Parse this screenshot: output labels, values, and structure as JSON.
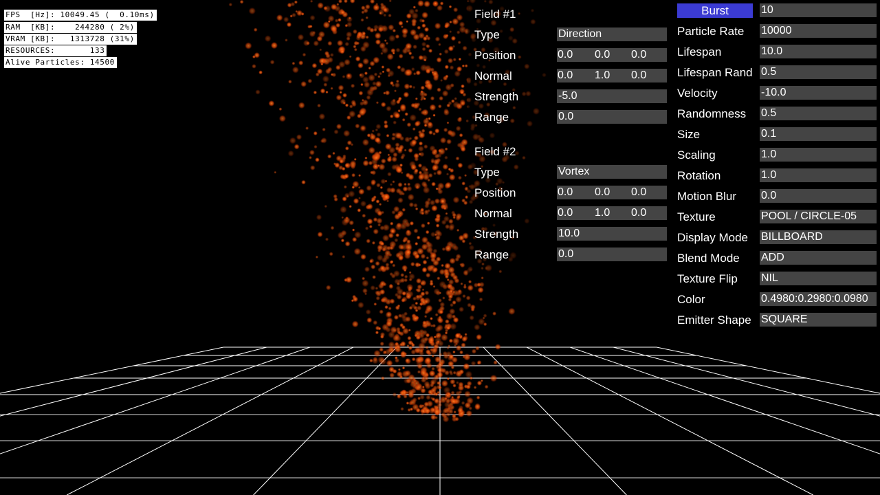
{
  "stats": [
    "FPS  [Hz]: 10049.45 (  0.10ms)",
    "RAM  [KB]:    244280 ( 2%)",
    "VRAM [KB]:   1313728 (31%)",
    "RESOURCES:       133",
    "Alive Particles: 14500"
  ],
  "field1": {
    "title": "Field #1",
    "type_label": "Type",
    "type_value": "Direction",
    "position_label": "Position",
    "position": [
      "0.0",
      "0.0",
      "0.0"
    ],
    "normal_label": "Normal",
    "normal": [
      "0.0",
      "1.0",
      "0.0"
    ],
    "strength_label": "Strength",
    "strength": "-5.0",
    "range_label": "Range",
    "range": "0.0"
  },
  "field2": {
    "title": "Field #2",
    "type_label": "Type",
    "type_value": "Vortex",
    "position_label": "Position",
    "position": [
      "0.0",
      "0.0",
      "0.0"
    ],
    "normal_label": "Normal",
    "normal": [
      "0.0",
      "1.0",
      "0.0"
    ],
    "strength_label": "Strength",
    "strength": "10.0",
    "range_label": "Range",
    "range": "0.0"
  },
  "emitter": {
    "burst_label": "Burst",
    "burst_value": "10",
    "props": [
      {
        "label": "Particle Rate",
        "value": "10000"
      },
      {
        "label": "Lifespan",
        "value": "10.0"
      },
      {
        "label": "Lifespan Rand",
        "value": "0.5"
      },
      {
        "label": "Velocity",
        "value": "-10.0"
      },
      {
        "label": "Randomness",
        "value": "0.5"
      },
      {
        "label": "Size",
        "value": "0.1"
      },
      {
        "label": "Scaling",
        "value": "1.0"
      },
      {
        "label": "Rotation",
        "value": "1.0"
      },
      {
        "label": "Motion Blur",
        "value": "0.0"
      },
      {
        "label": "Texture",
        "value": "POOL / CIRCLE-05"
      },
      {
        "label": "Display Mode",
        "value": "BILLBOARD"
      },
      {
        "label": "Blend Mode",
        "value": "ADD"
      },
      {
        "label": "Texture Flip",
        "value": "NIL"
      },
      {
        "label": "Color",
        "value": "0.4980:0.2980:0.0980"
      },
      {
        "label": "Emitter Shape",
        "value": "SQUARE"
      }
    ]
  },
  "colors": {
    "particle": "#ff5a0a",
    "grid": "#ffffff",
    "burst_button": "#3b3bd3",
    "field_box": "#444444"
  }
}
